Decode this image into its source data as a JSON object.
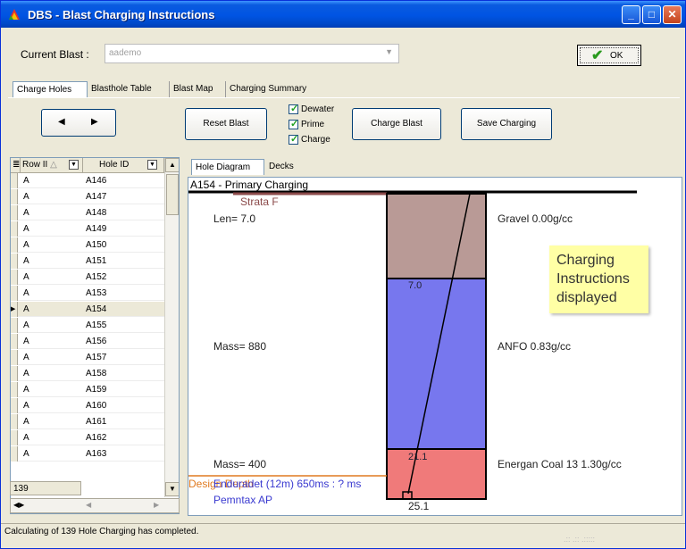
{
  "window": {
    "title": "DBS - Blast Charging Instructions"
  },
  "header": {
    "current_blast_label": "Current Blast :",
    "current_blast_value": "aademo",
    "ok_label": "OK"
  },
  "tabs": [
    {
      "label": "Charge Holes"
    },
    {
      "label": "Blasthole Table"
    },
    {
      "label": "Blast Map"
    },
    {
      "label": "Charging Summary"
    }
  ],
  "toolbar": {
    "reset_label": "Reset Blast",
    "charge_label": "Charge Blast",
    "save_label": "Save Charging",
    "checkboxes": [
      {
        "label": "Dewater",
        "checked": true
      },
      {
        "label": "Prime",
        "checked": true
      },
      {
        "label": "Charge",
        "checked": true
      }
    ]
  },
  "grid": {
    "columns": [
      "Row II",
      "Hole ID"
    ],
    "rows": [
      {
        "row": "A",
        "hole": "A146"
      },
      {
        "row": "A",
        "hole": "A147"
      },
      {
        "row": "A",
        "hole": "A148"
      },
      {
        "row": "A",
        "hole": "A149"
      },
      {
        "row": "A",
        "hole": "A150"
      },
      {
        "row": "A",
        "hole": "A151"
      },
      {
        "row": "A",
        "hole": "A152"
      },
      {
        "row": "A",
        "hole": "A153"
      },
      {
        "row": "A",
        "hole": "A154"
      },
      {
        "row": "A",
        "hole": "A155"
      },
      {
        "row": "A",
        "hole": "A156"
      },
      {
        "row": "A",
        "hole": "A157"
      },
      {
        "row": "A",
        "hole": "A158"
      },
      {
        "row": "A",
        "hole": "A159"
      },
      {
        "row": "A",
        "hole": "A160"
      },
      {
        "row": "A",
        "hole": "A161"
      },
      {
        "row": "A",
        "hole": "A162"
      },
      {
        "row": "A",
        "hole": "A163"
      }
    ],
    "selected_index": 8,
    "count": "139"
  },
  "diagram_tabs": [
    {
      "label": "Hole Diagram"
    },
    {
      "label": "Decks"
    }
  ],
  "diagram": {
    "title": "A154 - Primary Charging",
    "strata": "Strata F",
    "decks": [
      {
        "left_label": "Len= 7.0",
        "right_label": "Gravel 0.00g/cc",
        "color": "#b99a96"
      },
      {
        "left_label": "Mass= 880",
        "right_label": "ANFO 0.83g/cc",
        "color": "#7777ee"
      },
      {
        "left_label": "Mass= 400",
        "right_label": "Energan Coal 13 1.30g/cc",
        "color": "#f07a7a"
      }
    ],
    "depths": [
      "7.0",
      "21.1",
      "25.1"
    ],
    "design_label": "Design Depth",
    "primer_label": "Enduradet (12m) 650ms : ? ms",
    "booster_label": "Pemntax AP",
    "note": "Charging Instructions displayed"
  },
  "status": {
    "text": "Calculating of 139 Hole Charging has completed."
  }
}
